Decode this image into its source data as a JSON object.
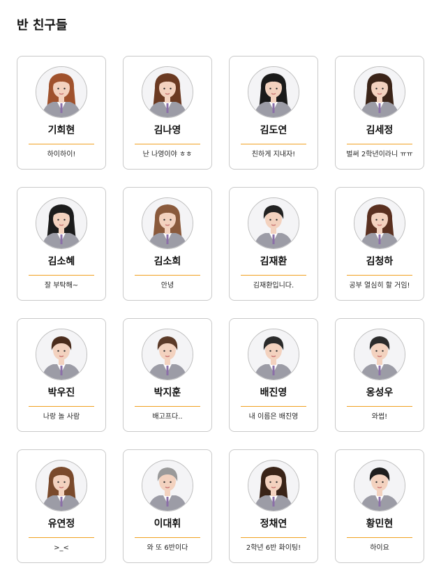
{
  "page": {
    "title": "반 친구들"
  },
  "friends": [
    {
      "name": "기희현",
      "message": "하이하이!",
      "hair": "#a0522d",
      "hair_style": "long"
    },
    {
      "name": "김나영",
      "message": "난 나영이야 ㅎㅎ",
      "hair": "#6b3a22",
      "hair_style": "long"
    },
    {
      "name": "김도연",
      "message": "친하게 지내자!",
      "hair": "#1a1a1a",
      "hair_style": "long"
    },
    {
      "name": "김세정",
      "message": "벌써 2학년이라니 ㅠㅠ",
      "hair": "#3b2418",
      "hair_style": "long"
    },
    {
      "name": "김소혜",
      "message": "잘 부탁해~",
      "hair": "#1c1c1c",
      "hair_style": "long"
    },
    {
      "name": "김소희",
      "message": "안녕",
      "hair": "#8a5a3c",
      "hair_style": "long"
    },
    {
      "name": "김재환",
      "message": "김재환입니다.",
      "hair": "#222222",
      "hair_style": "short"
    },
    {
      "name": "김청하",
      "message": "공부 열심히 할 거임!",
      "hair": "#5a3020",
      "hair_style": "long"
    },
    {
      "name": "박우진",
      "message": "나랑 놀 사람",
      "hair": "#4a2c1c",
      "hair_style": "short"
    },
    {
      "name": "박지훈",
      "message": "배고프다..",
      "hair": "#5b3a28",
      "hair_style": "short"
    },
    {
      "name": "배진영",
      "message": "내 이름은 배진영",
      "hair": "#2a2a2a",
      "hair_style": "short"
    },
    {
      "name": "옹성우",
      "message": "와썹!",
      "hair": "#2b2b2b",
      "hair_style": "short"
    },
    {
      "name": "유연정",
      "message": ">_<",
      "hair": "#7a4a2c",
      "hair_style": "long"
    },
    {
      "name": "이대휘",
      "message": "와 또 6반이다",
      "hair": "#9a9a9a",
      "hair_style": "short"
    },
    {
      "name": "정채연",
      "message": "2학년 6반 화이팅!",
      "hair": "#3a2418",
      "hair_style": "long"
    },
    {
      "name": "황민현",
      "message": "하이요",
      "hair": "#1e1e1e",
      "hair_style": "short"
    }
  ],
  "colors": {
    "accent": "#f0a020",
    "card_border": "#c9c9c9",
    "uniform": "#9c9ca6",
    "shirt": "#ffffff",
    "skin": "#f3d2bf"
  }
}
